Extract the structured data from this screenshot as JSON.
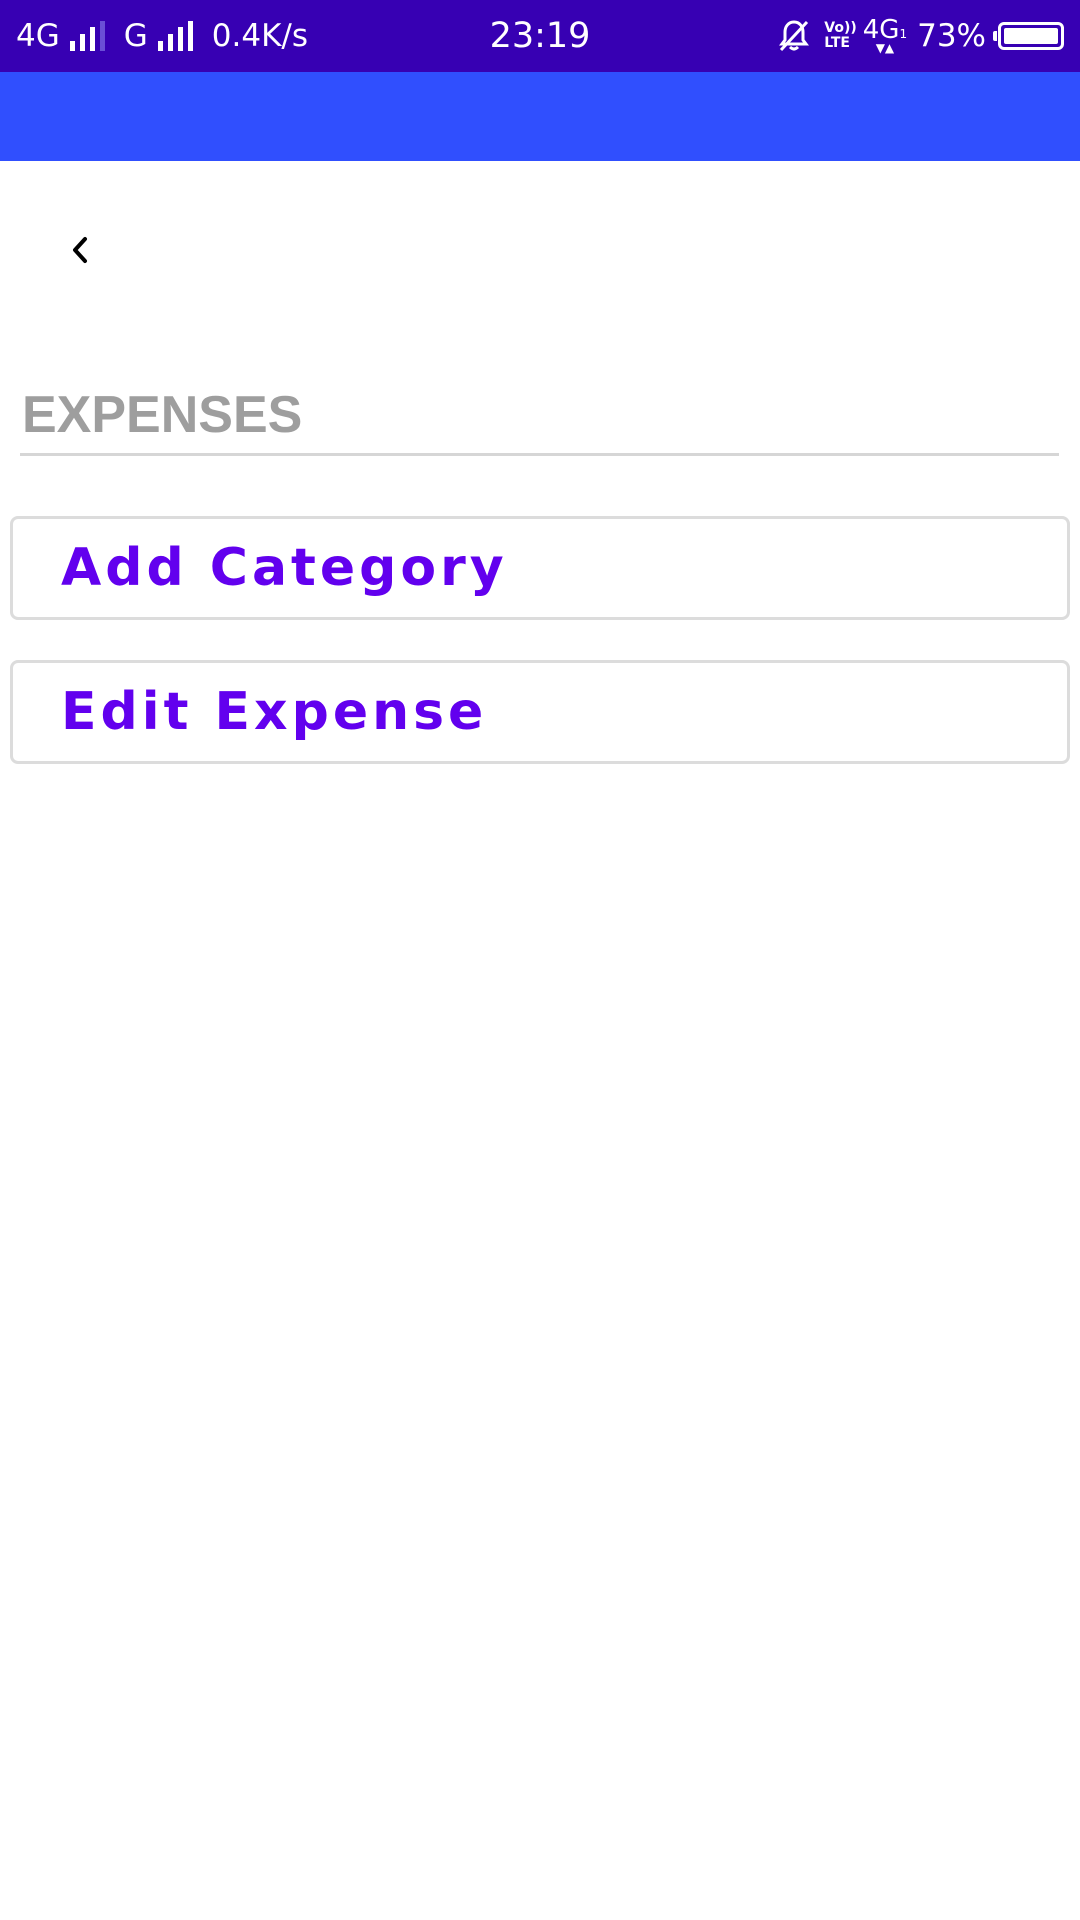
{
  "status_bar": {
    "network1": "4G",
    "network2": "G",
    "speed": "0.4K/s",
    "time": "23:19",
    "volte_top": "Vo))",
    "volte_bottom": "LTE",
    "network3": "4G",
    "network3_sub": "1",
    "battery": "73%",
    "background_color": "#3700b3"
  },
  "app_bar": {
    "background_color": "#304ffe"
  },
  "header": {
    "back_icon": "chevron-left-icon"
  },
  "section": {
    "title": "EXPENSES"
  },
  "options": [
    {
      "label": "Add Category"
    },
    {
      "label": "Edit Expense"
    }
  ],
  "colors": {
    "accent": "#6200ee",
    "title_gray": "#9e9e9e"
  }
}
